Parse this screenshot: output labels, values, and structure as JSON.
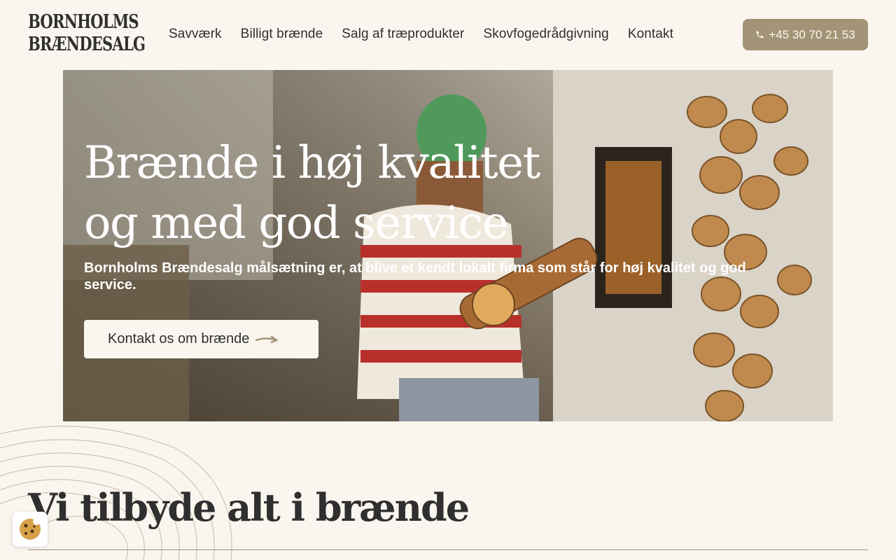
{
  "header": {
    "logo_line1": "BORNHOLMS",
    "logo_line2": "BRÆNDESALG",
    "nav": [
      "Savværk",
      "Billigt brænde",
      "Salg af træprodukter",
      "Skovfogedrådgivning",
      "Kontakt"
    ],
    "phone_label": "+45 30 70 21 53",
    "phone_icon": "phone-icon"
  },
  "hero": {
    "title": "Brænde i høj kvalitet og med god service",
    "subtitle": "Bornholms Brændesalg målsætning er, at blive et kendt lokalt firma som står for høj kvalitet og god service.",
    "cta_label": "Kontakt os om brænde",
    "cta_icon": "arrow-right-icon"
  },
  "section": {
    "title": "Vi tilbyde alt i brænde"
  },
  "cookie": {
    "icon": "cookie-icon"
  },
  "colors": {
    "background": "#faf6ef",
    "accent": "#a39477",
    "text": "#2f2f2f"
  }
}
